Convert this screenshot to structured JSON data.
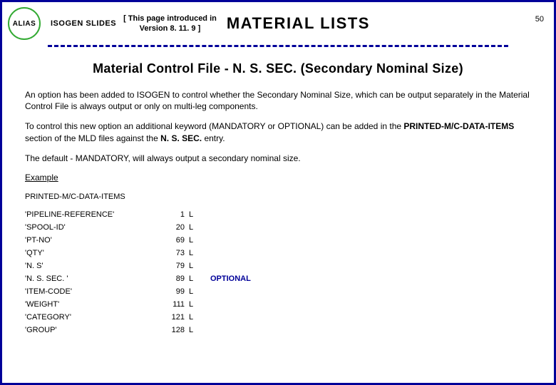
{
  "header": {
    "badge": "ALIAS",
    "isogen": "ISOGEN SLIDES",
    "intro_line1": "[ This page introduced in",
    "intro_line2": "Version 8. 11. 9 ]",
    "material_lists": "MATERIAL LISTS",
    "page_number": "50"
  },
  "title": "Material Control File - N. S. SEC. (Secondary Nominal Size)",
  "paragraphs": {
    "p1": "An option has been added to ISOGEN to control whether the Secondary Nominal Size, which can be output separately in the Material Control File is always output or only on multi-leg components.",
    "p2_a": "To control this new option an additional keyword (MANDATORY or OPTIONAL) can be added in the ",
    "p2_b": "PRINTED-M/C-DATA-ITEMS",
    "p2_c": " section of the MLD files against the ",
    "p2_d": "N. S. SEC.",
    "p2_e": " entry.",
    "p3": "The default - MANDATORY, will always output a secondary nominal size."
  },
  "example_label": "Example",
  "section_label": "PRINTED-M/C-DATA-ITEMS",
  "items": [
    {
      "name": "'PIPELINE-REFERENCE'",
      "num": "1",
      "l": "L",
      "note": ""
    },
    {
      "name": "'SPOOL-ID'",
      "num": "20",
      "l": "L",
      "note": ""
    },
    {
      "name": "'PT-NO'",
      "num": "69",
      "l": "L",
      "note": ""
    },
    {
      "name": "'QTY'",
      "num": "73",
      "l": "L",
      "note": ""
    },
    {
      "name": "'N. S'",
      "num": "79",
      "l": "L",
      "note": ""
    },
    {
      "name": "'N. S. SEC. '",
      "num": "89",
      "l": "L",
      "note": "OPTIONAL"
    },
    {
      "name": "'ITEM-CODE'",
      "num": "99",
      "l": "L",
      "note": ""
    },
    {
      "name": "'WEIGHT'",
      "num": "111",
      "l": "L",
      "note": ""
    },
    {
      "name": "'CATEGORY'",
      "num": "121",
      "l": "L",
      "note": ""
    },
    {
      "name": "'GROUP'",
      "num": "128",
      "l": "L",
      "note": ""
    }
  ]
}
